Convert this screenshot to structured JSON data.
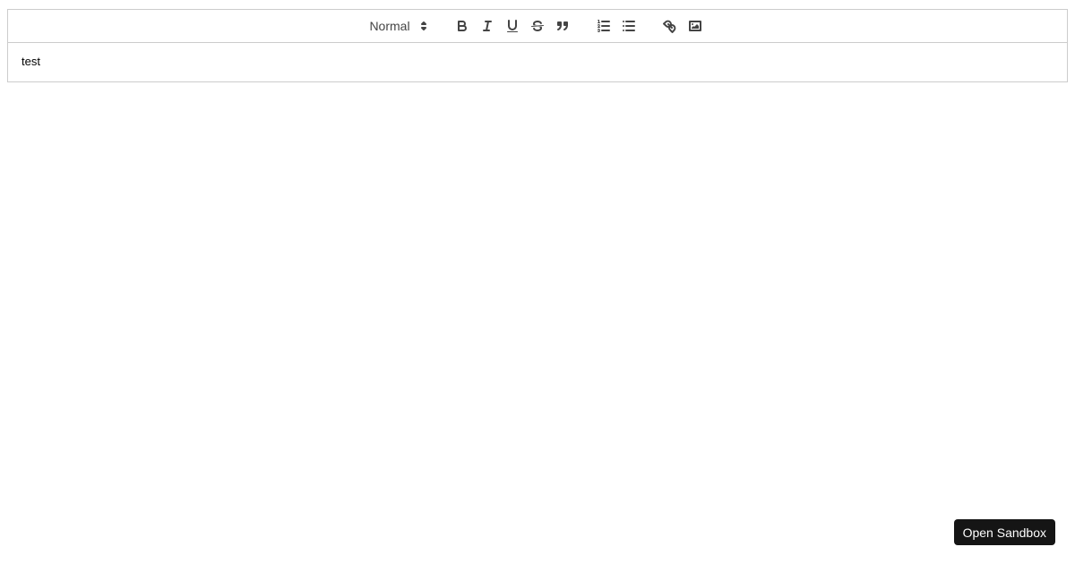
{
  "colors": {
    "border": "#cccccc",
    "icon": "#444444",
    "editor_text": "#000000",
    "sandbox_button_bg": "#151515",
    "sandbox_button_text": "#ffffff"
  },
  "toolbar": {
    "header_picker": {
      "selected": "Normal",
      "icon": "up-down-arrows-icon"
    },
    "buttons": [
      {
        "name": "bold",
        "icon": "bold-icon"
      },
      {
        "name": "italic",
        "icon": "italic-icon"
      },
      {
        "name": "underline",
        "icon": "underline-icon"
      },
      {
        "name": "strikethrough",
        "icon": "strikethrough-icon"
      },
      {
        "name": "blockquote",
        "icon": "blockquote-icon"
      },
      {
        "name": "ordered-list",
        "icon": "ordered-list-icon"
      },
      {
        "name": "bullet-list",
        "icon": "bullet-list-icon"
      },
      {
        "name": "link",
        "icon": "link-icon"
      },
      {
        "name": "image",
        "icon": "image-icon"
      }
    ]
  },
  "editor": {
    "content": "test"
  },
  "sandbox": {
    "button_label": "Open Sandbox"
  }
}
